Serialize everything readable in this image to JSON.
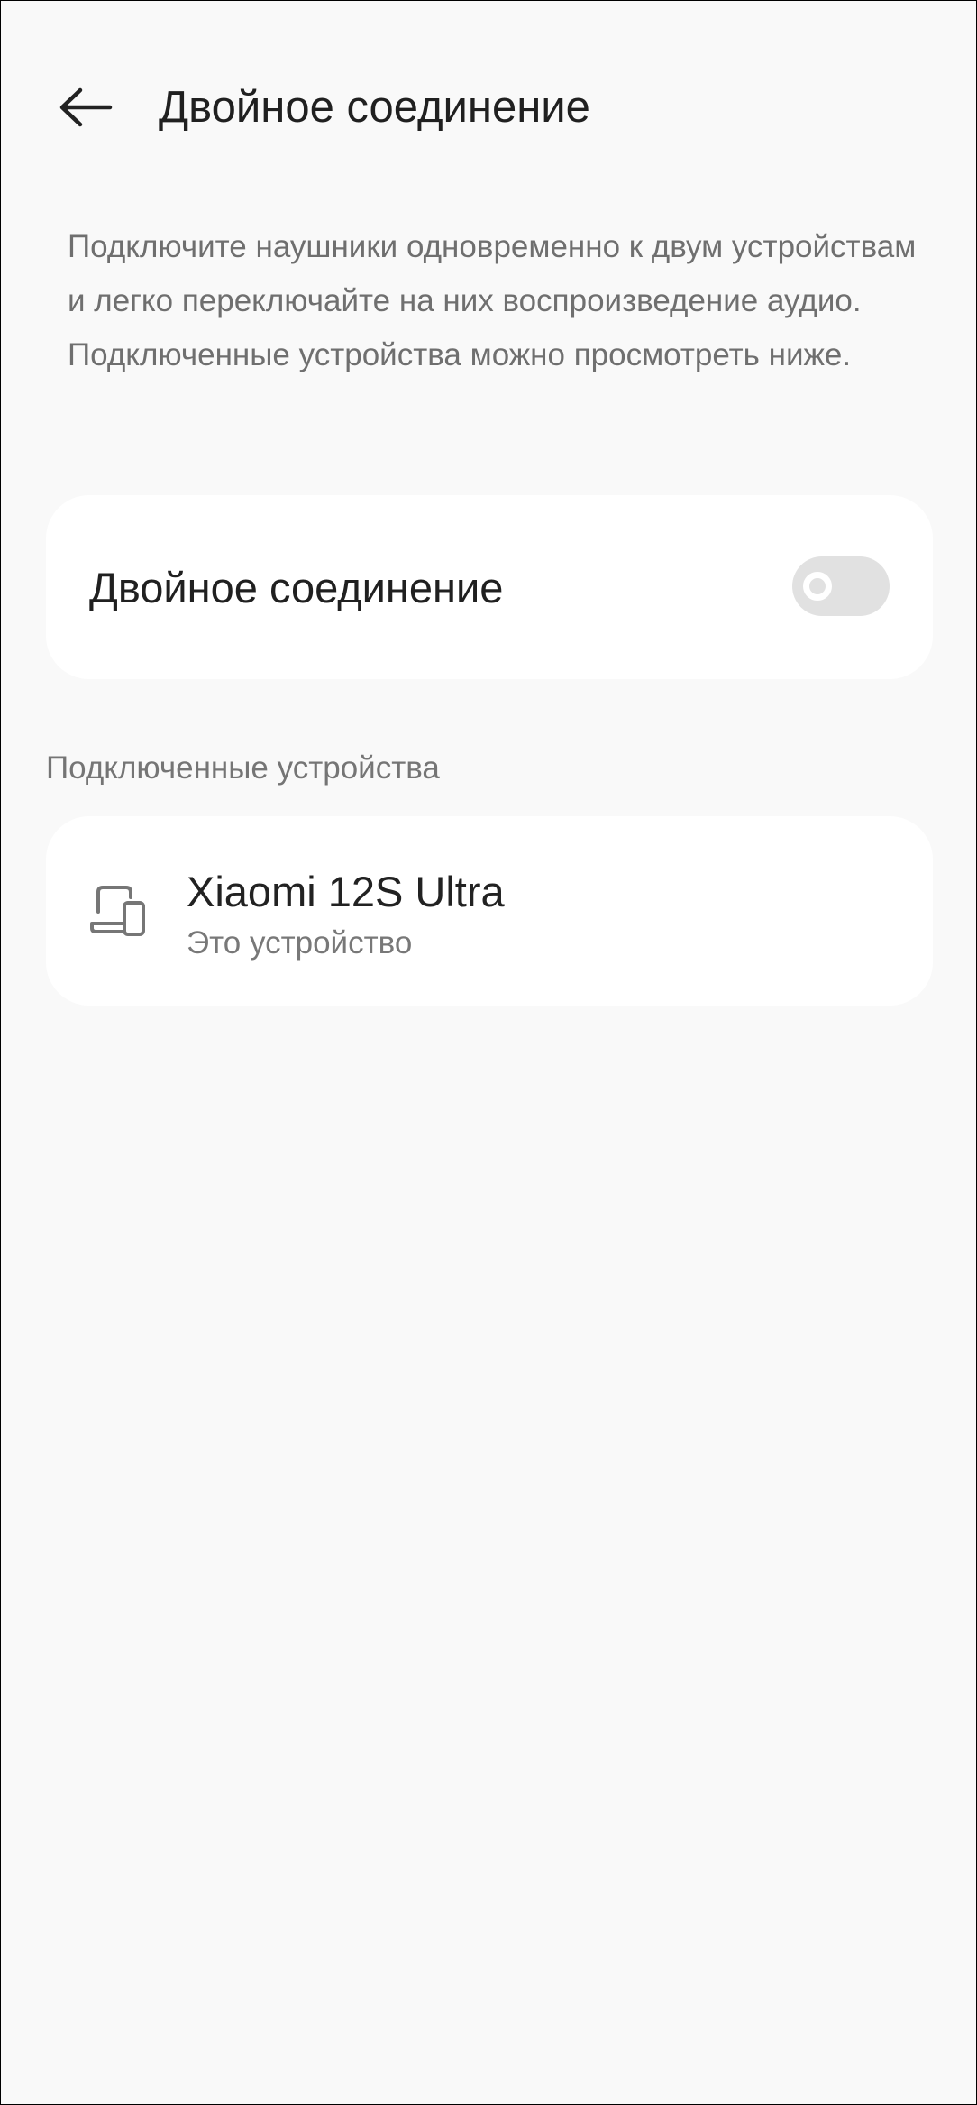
{
  "header": {
    "back_icon": "arrow-left-icon",
    "title": "Двойное соединение"
  },
  "description": "Подключите наушники одновременно к двум устройствам и легко переключайте на них воспроизведение аудио. Подключенные устройства можно просмотреть ниже.",
  "dual_connection": {
    "label": "Двойное соединение",
    "enabled": false
  },
  "connected_devices": {
    "section_label": "Подключенные устройства",
    "items": [
      {
        "icon": "devices-icon",
        "name": "Xiaomi 12S Ultra",
        "subtitle": "Это устройство"
      }
    ]
  },
  "colors": {
    "background": "#f9f9f9",
    "card": "#ffffff",
    "switch_off": "#e1e1e1",
    "secondary_text": "#6f6f6f"
  }
}
